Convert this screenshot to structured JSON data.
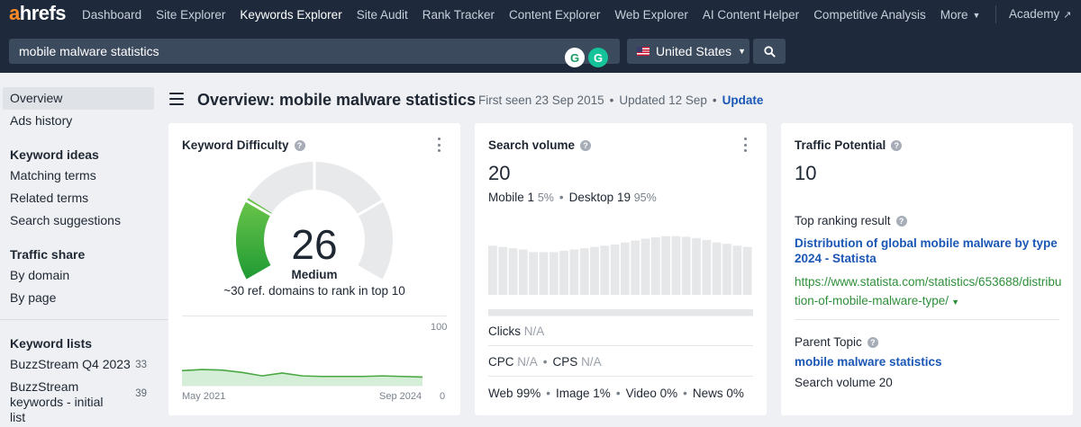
{
  "nav": {
    "logo_a": "a",
    "logo_rest": "hrefs",
    "items": [
      {
        "label": "Dashboard",
        "active": false
      },
      {
        "label": "Site Explorer",
        "active": false
      },
      {
        "label": "Keywords Explorer",
        "active": true
      },
      {
        "label": "Site Audit",
        "active": false
      },
      {
        "label": "Rank Tracker",
        "active": false
      },
      {
        "label": "Content Explorer",
        "active": false
      },
      {
        "label": "Web Explorer",
        "active": false
      },
      {
        "label": "AI Content Helper",
        "active": false
      },
      {
        "label": "Competitive Analysis",
        "active": false
      }
    ],
    "more_label": "More",
    "academy_label": "Academy"
  },
  "search": {
    "query": "mobile malware statistics",
    "country": "United States",
    "extension_icons": [
      "G",
      "G"
    ]
  },
  "sidebar": {
    "top_items": [
      "Overview",
      "Ads history"
    ],
    "keyword_ideas_heading": "Keyword ideas",
    "keyword_ideas": [
      "Matching terms",
      "Related terms",
      "Search suggestions"
    ],
    "traffic_share_heading": "Traffic share",
    "traffic_share": [
      "By domain",
      "By page"
    ],
    "keyword_lists_heading": "Keyword lists",
    "keyword_lists": [
      {
        "name": "BuzzStream Q4 2023",
        "count": "33"
      },
      {
        "name": "BuzzStream keywords - initial list",
        "count": "39"
      }
    ]
  },
  "header": {
    "title": "Overview: mobile malware statistics",
    "first_seen": "First seen 23 Sep 2015",
    "updated": "Updated 12 Sep",
    "update_link": "Update"
  },
  "kd": {
    "title": "Keyword Difficulty",
    "value": "26",
    "level": "Medium",
    "subtitle": "~30 ref. domains to rank in top 10",
    "gauge_fraction": 0.26,
    "chart": {
      "y_max_label": "100",
      "y_min_label": "0",
      "start_label": "May 2021",
      "end_label": "Sep 2024",
      "values": [
        26,
        28,
        27,
        23,
        17,
        22,
        17,
        16,
        16,
        16,
        17,
        16,
        15
      ]
    }
  },
  "sv": {
    "title": "Search volume",
    "value": "20",
    "mobile_label": "Mobile",
    "mobile_value": "1",
    "mobile_pct": "5%",
    "desktop_label": "Desktop",
    "desktop_value": "19",
    "desktop_pct": "95%",
    "bars": [
      0.77,
      0.75,
      0.73,
      0.71,
      0.67,
      0.67,
      0.67,
      0.69,
      0.71,
      0.73,
      0.75,
      0.77,
      0.79,
      0.82,
      0.85,
      0.88,
      0.9,
      0.92,
      0.92,
      0.91,
      0.89,
      0.86,
      0.82,
      0.8,
      0.77,
      0.75
    ],
    "clicks_label": "Clicks",
    "clicks_value": "N/A",
    "cpc_label": "CPC",
    "cpc_value": "N/A",
    "cps_label": "CPS",
    "cps_value": "N/A",
    "serp_features": [
      "Web 99%",
      "Image 1%",
      "Video 0%",
      "News 0%"
    ]
  },
  "tp": {
    "title": "Traffic Potential",
    "value": "10",
    "top_result_label": "Top ranking result",
    "top_result_title": "Distribution of global mobile malware by type 2024 - Statista",
    "top_result_url": "https://www.statista.com/statistics/653688/distribution-of-mobile-malware-type/",
    "parent_topic_label": "Parent Topic",
    "parent_topic": "mobile malware statistics",
    "parent_volume": "Search volume 20"
  },
  "colors": {
    "nav_bg": "#1e2a3b",
    "accent_orange": "#ff8b24",
    "link_blue": "#1a57b5",
    "url_green": "#2e8f3a",
    "gauge_green": "#2aa33a",
    "gauge_gray": "#e8e9eb",
    "bar_gray": "#e6e7e9"
  }
}
